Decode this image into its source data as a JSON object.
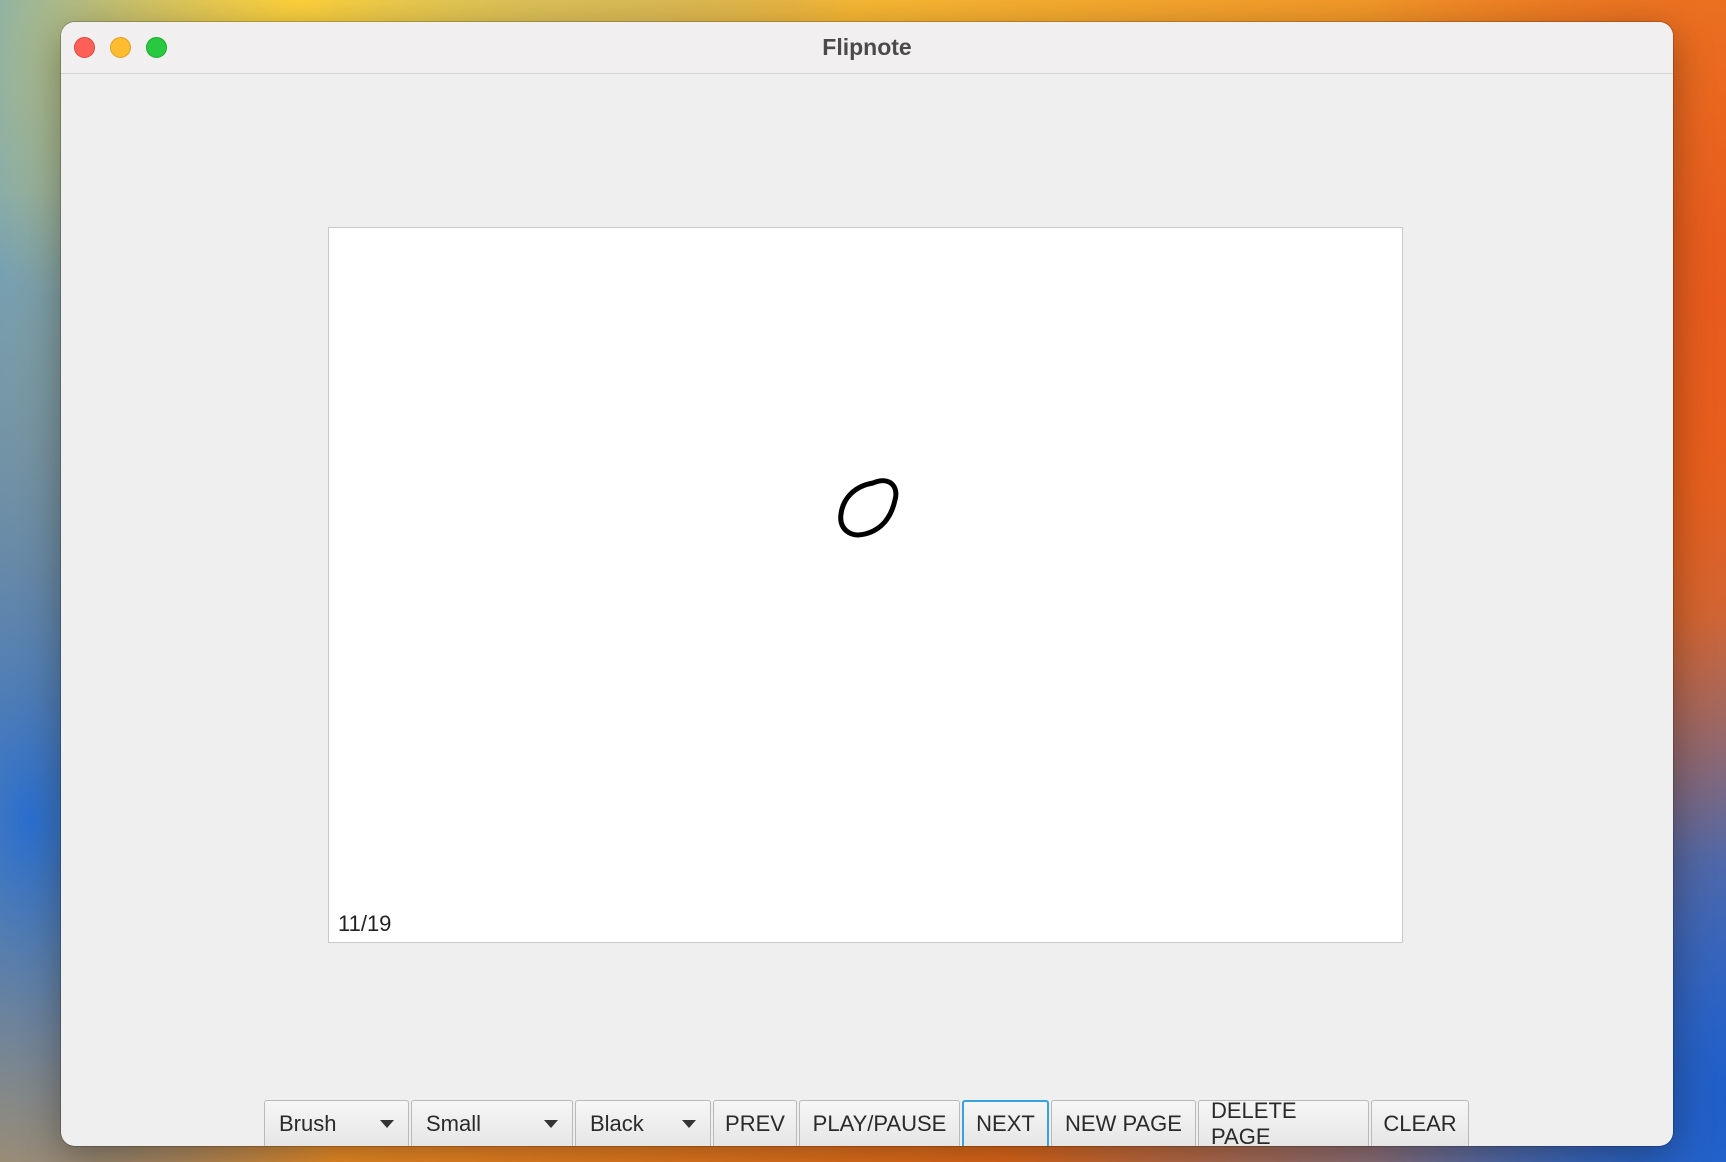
{
  "window": {
    "title": "Flipnote"
  },
  "canvas": {
    "page_indicator": "11/19"
  },
  "toolbar": {
    "tool_select": "Brush",
    "size_select": "Small",
    "color_select": "Black",
    "prev_label": "PREV",
    "play_pause_label": "PLAY/PAUSE",
    "next_label": "NEXT",
    "new_page_label": "NEW PAGE",
    "delete_page_label": "DELETE PAGE",
    "clear_label": "CLEAR"
  },
  "colors": {
    "focus_ring": "#3aa0e0",
    "stroke": "#000000"
  }
}
